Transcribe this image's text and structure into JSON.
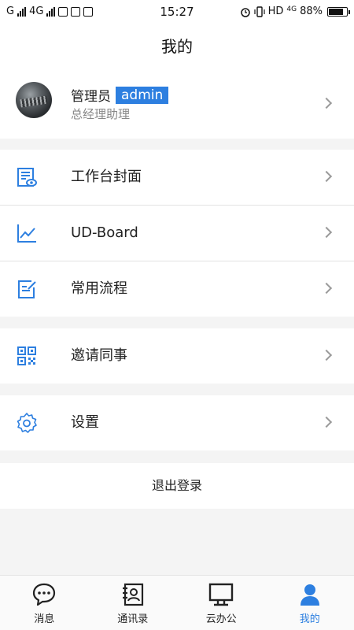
{
  "status_bar": {
    "carrier_left": "G",
    "network": "4G",
    "time": "15:27",
    "hd": "HD",
    "lte": "4G",
    "battery": "88%",
    "battery_level": 0.88,
    "icons": [
      "signal-icon",
      "sms-icon",
      "safe-icon",
      "app-icon",
      "alarm-icon",
      "vibrate-icon",
      "battery-icon"
    ]
  },
  "header": {
    "title": "我的"
  },
  "profile": {
    "name": "管理员",
    "tag": "admin",
    "role": "总经理助理"
  },
  "menu": {
    "items": [
      {
        "label": "工作台封面",
        "icon": "dashboard-cover-icon"
      },
      {
        "label": "UD-Board",
        "icon": "line-chart-icon"
      },
      {
        "label": "常用流程",
        "icon": "edit-form-icon"
      },
      {
        "label": "邀请同事",
        "icon": "qr-code-icon"
      },
      {
        "label": "设置",
        "icon": "gear-icon"
      }
    ],
    "logout": "退出登录"
  },
  "tabbar": {
    "items": [
      {
        "label": "消息",
        "icon": "chat-bubble-icon",
        "active": false
      },
      {
        "label": "通讯录",
        "icon": "contacts-book-icon",
        "active": false
      },
      {
        "label": "云办公",
        "icon": "monitor-icon",
        "active": false
      },
      {
        "label": "我的",
        "icon": "user-icon",
        "active": true
      }
    ]
  },
  "colors": {
    "accent": "#2d7fe0",
    "background": "#f4f4f4",
    "card": "#ffffff",
    "secondary_text": "#888888"
  }
}
